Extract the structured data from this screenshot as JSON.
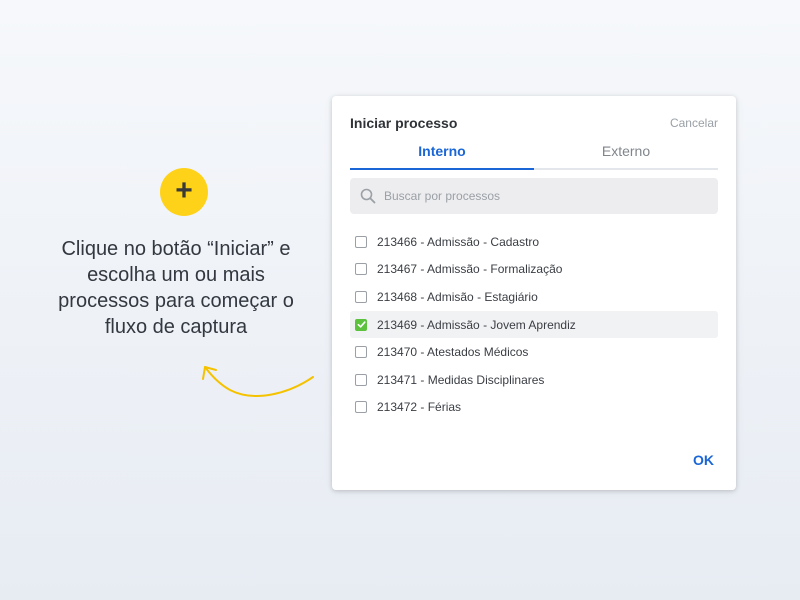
{
  "instructions": {
    "plus_symbol": "+",
    "caption": "Clique no botão “Iniciar” e escolha um ou mais processos para começar o fluxo de captura"
  },
  "dialog": {
    "title": "Iniciar processo",
    "cancel_label": "Cancelar",
    "tabs": [
      {
        "label": "Interno",
        "active": true
      },
      {
        "label": "Externo",
        "active": false
      }
    ],
    "search": {
      "placeholder": "Buscar por processos",
      "value": ""
    },
    "processes": [
      {
        "label": "213466 - Admissão - Cadastro",
        "checked": false
      },
      {
        "label": "213467 - Admissão - Formalização",
        "checked": false
      },
      {
        "label": "213468 - Admisão - Estagiário",
        "checked": false
      },
      {
        "label": "213469 - Admissão - Jovem Aprendiz",
        "checked": true
      },
      {
        "label": "213470 - Atestados Médicos",
        "checked": false
      },
      {
        "label": "213471 - Medidas Disciplinares",
        "checked": false
      },
      {
        "label": "213472 - Férias",
        "checked": false
      }
    ],
    "ok_label": "OK"
  },
  "colors": {
    "accent": "#1a66d6",
    "highlight_yellow": "#ffd21a",
    "checkbox_checked": "#5cc23d"
  },
  "icons": {
    "plus": "plus-icon",
    "search": "search-icon",
    "arrow": "curved-arrow-icon",
    "check": "check-icon"
  }
}
